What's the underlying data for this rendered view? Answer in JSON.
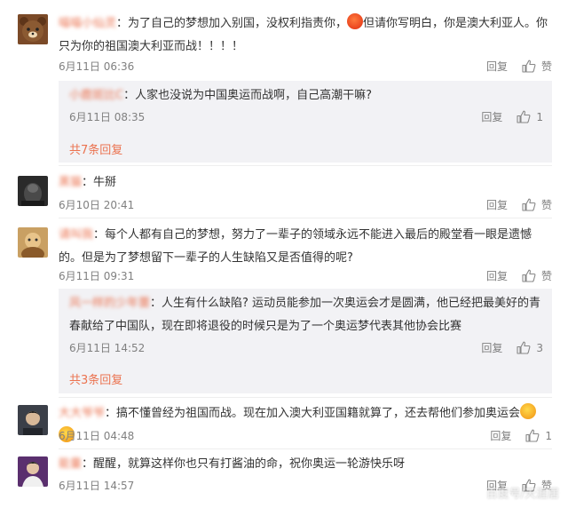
{
  "comments": [
    {
      "name": "喵喵小仙灵",
      "text_a": "：为了自己的梦想加入别国，没权利指责你，",
      "text_b": "但请你写明白，你是澳大利亚人。你只为你的祖国澳大利亚而战！！！！",
      "time": "6月11日 06:36",
      "reply": "回复",
      "like": "赞",
      "sub": {
        "name": "小鹿斑比C",
        "text": "：人家也没说为中国奥运而战啊，自己高潮干嘛?",
        "time": "6月11日 08:35",
        "reply": "回复",
        "like": "1",
        "more": "共7条回复"
      }
    },
    {
      "name": "黑猫",
      "text": "：牛掰",
      "time": "6月10日 20:41",
      "reply": "回复",
      "like": "赞"
    },
    {
      "name": "请叫我",
      "text": "：每个人都有自己的梦想，努力了一辈子的领域永远不能进入最后的殿堂看一眼是遗憾的。但是为了梦想留下一辈子的人生缺陷又是否值得的呢?",
      "time": "6月11日 09:31",
      "reply": "回复",
      "like": "赞",
      "sub": {
        "name": "风一样的少年蕾",
        "text": "：人生有什么缺陷? 运动员能参加一次奥运会才是圆满，他已经把最美好的青春献给了中国队，现在即将退役的时候只是为了一个奥运梦代表其他协会比赛",
        "time": "6月11日 14:52",
        "reply": "回复",
        "like": "3",
        "more": "共3条回复"
      }
    },
    {
      "name": "大大爷爷",
      "text": "：搞不懂曾经为祖国而战。现在加入澳大利亚国籍就算了，还去帮他们参加奥运会",
      "time": "6月11日 04:48",
      "reply": "回复",
      "like": "1"
    },
    {
      "name": "能量",
      "text": "：醒醒，就算这样你也只有打酱油的命，祝你奥运一轮游快乐呀",
      "time": "6月11日 14:57",
      "reply": "回复",
      "like": "赞"
    }
  ],
  "watermark": "百度号/天涯居",
  "colors": {
    "name": "#eb7350",
    "meta": "#808080",
    "subbox": "#f2f2f5"
  },
  "icons": {
    "like": "thumbs-up-icon",
    "emoji_angry": "angry-face-emoji",
    "emoji_grin": "grin-emoji"
  }
}
